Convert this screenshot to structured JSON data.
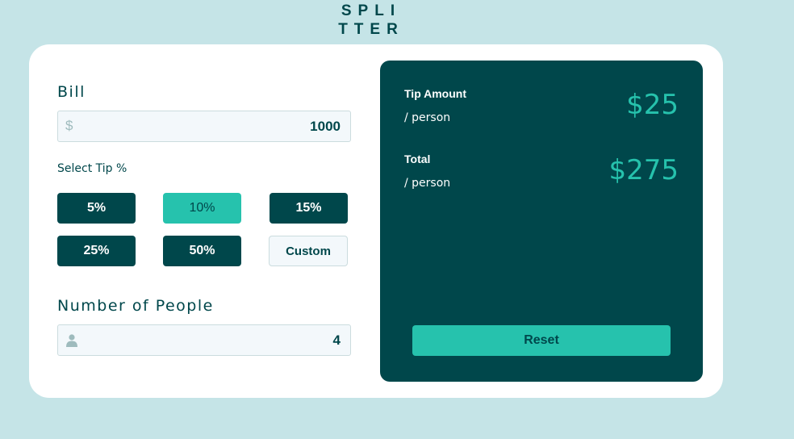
{
  "logo": {
    "line1": "SPLI",
    "line2": "TTER"
  },
  "bill": {
    "label": "Bill",
    "prefix": "$",
    "value": "1000"
  },
  "tip": {
    "label": "Select Tip %",
    "options": [
      "5%",
      "10%",
      "15%",
      "25%",
      "50%"
    ],
    "selected": "10%",
    "custom_label": "Custom"
  },
  "people": {
    "label": "Number of People",
    "value": "4"
  },
  "result": {
    "tip_amount_label": "Tip Amount",
    "tip_per_person_label": "/ person",
    "tip_amount_value": "$25",
    "total_label": "Total",
    "total_per_person_label": "/ person",
    "total_value": "$275",
    "reset_label": "Reset"
  },
  "colors": {
    "background": "#c5e4e7",
    "panel": "#00474b",
    "accent": "#26c2ad"
  },
  "icons": {
    "bill_prefix": "dollar-icon",
    "people_prefix": "person-icon"
  }
}
